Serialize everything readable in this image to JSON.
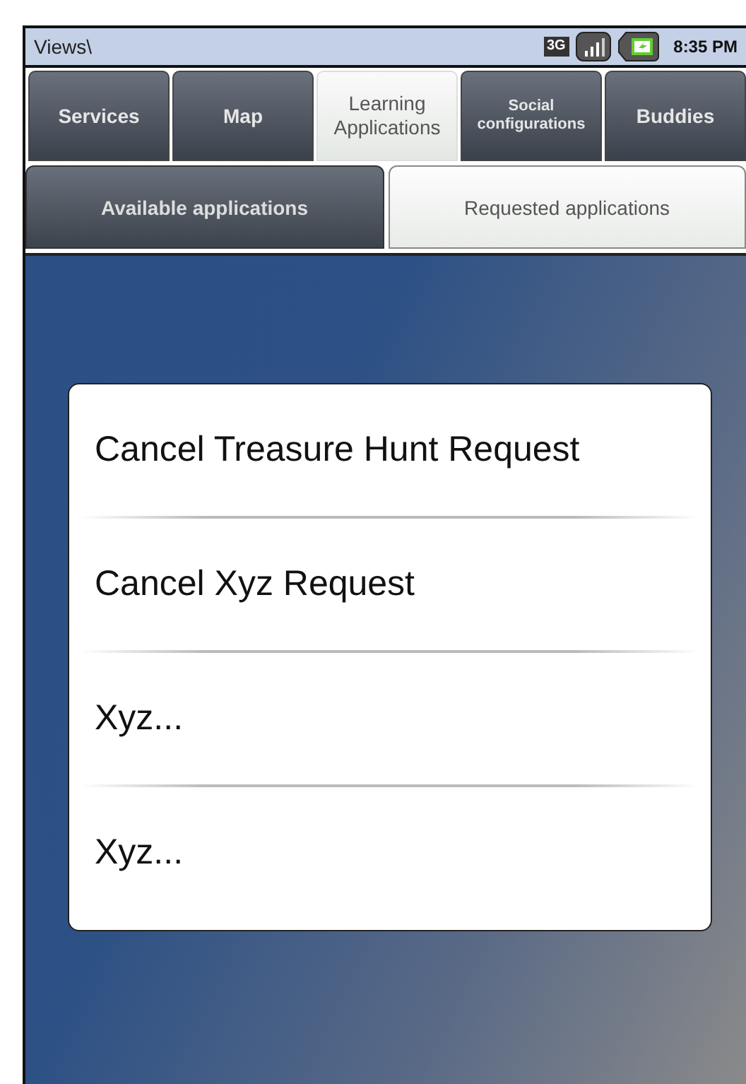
{
  "status_bar": {
    "title": "Views\\",
    "network": "3G",
    "time": "8:35 PM"
  },
  "tabs": [
    {
      "label": "Services",
      "selected": false
    },
    {
      "label": "Map",
      "selected": false
    },
    {
      "label": "Learning Applications",
      "selected": true
    },
    {
      "label": "Social configurations",
      "selected": false,
      "small": true
    },
    {
      "label": "Buddies",
      "selected": false
    }
  ],
  "subtabs": [
    {
      "label": "Available applications",
      "selected": false
    },
    {
      "label": "Requested applications",
      "selected": true
    }
  ],
  "menu": {
    "items": [
      "Cancel Treasure Hunt Request",
      "Cancel Xyz Request",
      "Xyz...",
      "Xyz..."
    ]
  }
}
